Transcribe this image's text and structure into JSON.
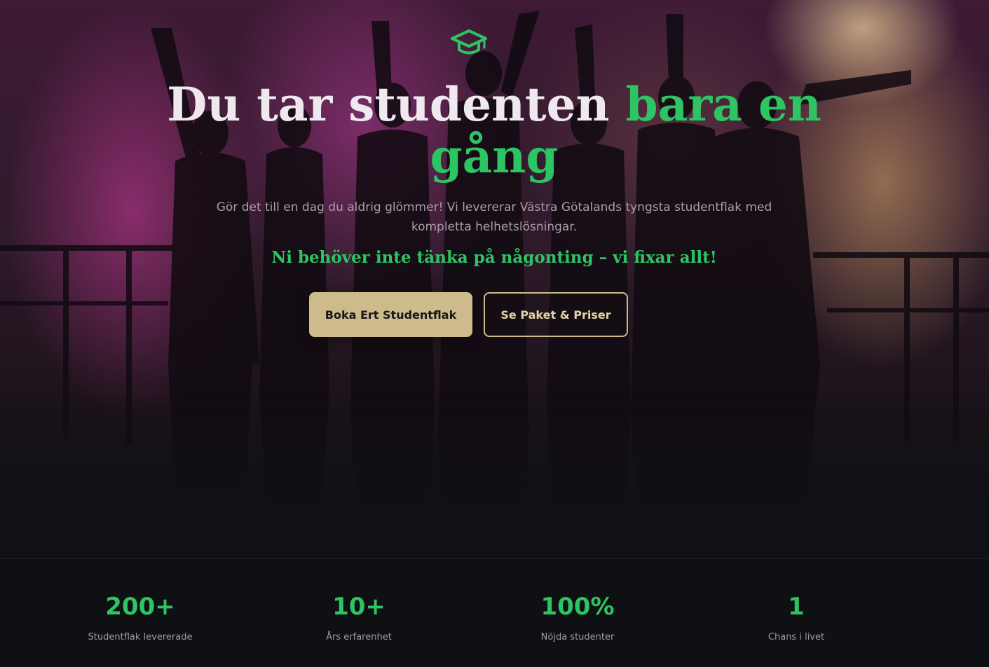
{
  "hero": {
    "icon": "graduation-cap-icon",
    "title_part1": "Du tar studenten",
    "title_accent": "bara en gång",
    "subtitle": "Gör det till en dag du aldrig glömmer! Vi levererar Västra Götalands tyngsta studentflak med kompletta helhetslösningar.",
    "tagline": "Ni behöver inte tänka på någonting – vi fixar allt!",
    "primary_button": "Boka Ert Studentflak",
    "secondary_button": "Se Paket & Priser"
  },
  "stats": [
    {
      "value": "200+",
      "label": "Studentflak levererade"
    },
    {
      "value": "10+",
      "label": "Års erfarenhet"
    },
    {
      "value": "100%",
      "label": "Nöjda studenter"
    },
    {
      "value": "1",
      "label": "Chans i livet"
    }
  ],
  "colors": {
    "accent_green": "#2ec463",
    "gold": "#cdbb8b",
    "background": "#0e1014"
  }
}
